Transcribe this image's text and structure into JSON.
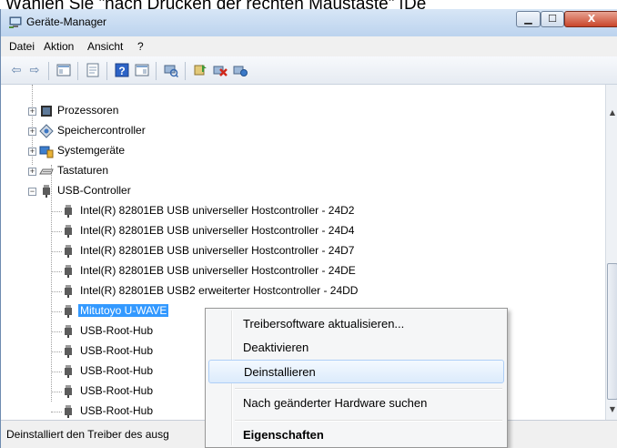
{
  "caption": "Wählen Sie \"nach Drücken der rechten Maustaste\" [De",
  "window": {
    "title": "Geräte-Manager"
  },
  "menubar": [
    "Datei",
    "Aktion",
    "Ansicht",
    "?"
  ],
  "toolbar_icons": [
    "back-arrow-icon",
    "forward-arrow-icon",
    "console-tree-icon",
    "properties-icon",
    "help-icon",
    "view-icon",
    "scan-hardware-icon",
    "update-driver-icon",
    "uninstall-icon",
    "disable-icon"
  ],
  "tree": {
    "categories": [
      {
        "label": "Prozessoren",
        "icon": "processor-icon",
        "expanded": false
      },
      {
        "label": "Speichercontroller",
        "icon": "storage-controller-icon",
        "expanded": false
      },
      {
        "label": "Systemgeräte",
        "icon": "system-devices-icon",
        "expanded": false
      },
      {
        "label": "Tastaturen",
        "icon": "keyboard-icon",
        "expanded": false
      },
      {
        "label": "USB-Controller",
        "icon": "usb-icon",
        "expanded": true
      }
    ],
    "usb_children": [
      "Intel(R) 82801EB USB universeller Hostcontroller - 24D2",
      "Intel(R) 82801EB USB universeller Hostcontroller - 24D4",
      "Intel(R) 82801EB USB universeller Hostcontroller - 24D7",
      "Intel(R) 82801EB USB universeller Hostcontroller - 24DE",
      "Intel(R) 82801EB USB2 erweiterter Hostcontroller - 24DD",
      "Mitutoyo U-WAVE",
      "USB-Root-Hub",
      "USB-Root-Hub",
      "USB-Root-Hub",
      "USB-Root-Hub",
      "USB-Root-Hub"
    ],
    "selected": "Mitutoyo U-WAVE"
  },
  "context_menu": {
    "items": [
      {
        "label": "Treibersoftware aktualisieren...",
        "highlighted": false,
        "bold": false
      },
      {
        "label": "Deaktivieren",
        "highlighted": false,
        "bold": false
      },
      {
        "label": "Deinstallieren",
        "highlighted": true,
        "bold": false
      },
      {
        "label": "Nach geänderter Hardware suchen",
        "highlighted": false,
        "bold": false
      },
      {
        "label": "Eigenschaften",
        "highlighted": false,
        "bold": true
      }
    ]
  },
  "status_text": "Deinstalliert den Treiber des ausg",
  "colors": {
    "selection": "#3399ff",
    "menu_highlight_border": "#aecff7",
    "window_frame": "#bcd3ee"
  }
}
